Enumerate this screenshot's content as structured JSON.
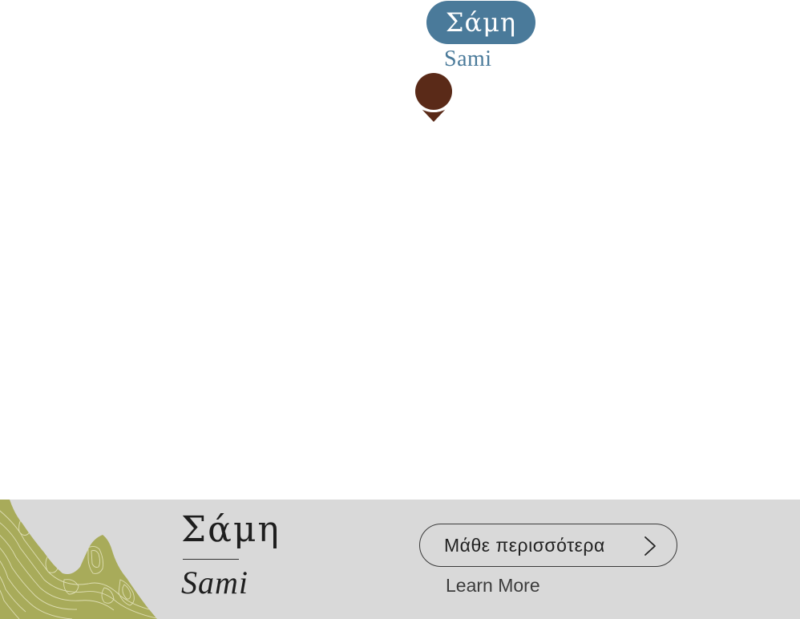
{
  "map": {
    "marker": {
      "name_greek": "Σάμη",
      "name_latin": "Sami"
    }
  },
  "info_bar": {
    "title_greek": "Σάμη",
    "title_latin": "Sami",
    "learn_more_greek": "Μάθε περισσότερα",
    "learn_more_english": "Learn More",
    "icons": [
      "map-thumbnail-icon",
      "chevron-right-icon"
    ]
  },
  "colors": {
    "marker_pill": "#4a7a9a",
    "marker_pin": "#5a2a18",
    "info_bar_bg": "#d9d9d9",
    "topo_green": "#a8ab5a"
  }
}
